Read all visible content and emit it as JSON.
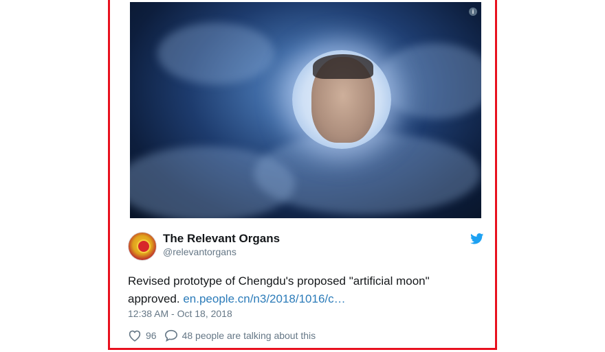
{
  "tweet": {
    "display_name": "The Relevant Organs",
    "handle": "@relevantorgans",
    "text_main": "Revised prototype of Chengdu's proposed \"artificial moon\" approved. ",
    "link_text": "en.people.cn/n3/2018/1016/c…",
    "timestamp": "12:38 AM - Oct 18, 2018",
    "likes_count": "96",
    "talking_text": "48 people are talking about this"
  },
  "icons": {
    "info": "info-icon",
    "bird": "twitter-bird-icon",
    "heart": "heart-icon",
    "reply": "comment-bubble-icon"
  },
  "colors": {
    "border": "#e8101e",
    "link": "#2b7bb9",
    "twitter_blue": "#1da1f2",
    "muted": "#657786"
  }
}
